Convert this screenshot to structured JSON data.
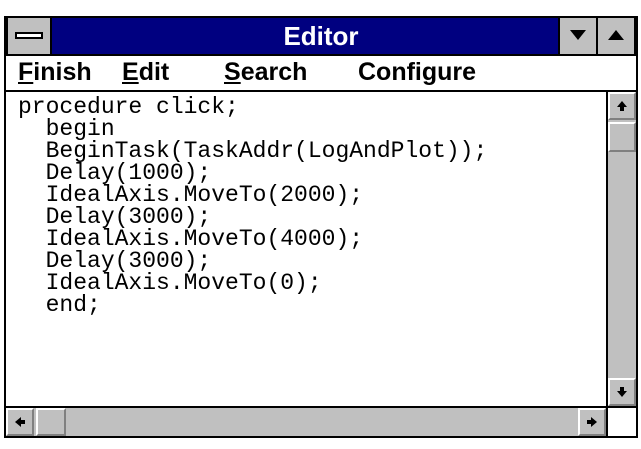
{
  "window": {
    "title": "Editor",
    "title_bar_color": "#000080"
  },
  "menu": {
    "finish": {
      "mnemonic": "F",
      "rest": "inish"
    },
    "edit": {
      "mnemonic": "E",
      "rest": "dit"
    },
    "search": {
      "mnemonic": "S",
      "rest": "earch"
    },
    "configure": "Configure"
  },
  "editor": {
    "lines": [
      "procedure click;",
      "  begin",
      "  BeginTask(TaskAddr(LogAndPlot));",
      "  Delay(1000);",
      "  IdealAxis.MoveTo(2000);",
      "  Delay(3000);",
      "  IdealAxis.MoveTo(4000);",
      "  Delay(3000);",
      "  IdealAxis.MoveTo(0);",
      "  end;"
    ]
  },
  "icons": {
    "system_menu": "system-menu-icon",
    "minimize": "triangle-down-icon",
    "maximize": "triangle-up-icon",
    "scroll_up": "arrow-up-icon",
    "scroll_down": "arrow-down-icon",
    "scroll_left": "arrow-left-icon",
    "scroll_right": "arrow-right-icon"
  }
}
